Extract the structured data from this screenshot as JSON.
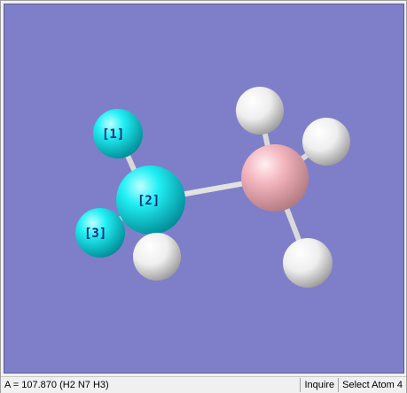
{
  "viewer": {
    "background_color": "#7f7fc9",
    "atoms": [
      {
        "id": "atom-1",
        "label": "[1]",
        "element": "N",
        "color": "#00e5ee"
      },
      {
        "id": "atom-2",
        "label": "[2]",
        "element": "N",
        "color": "#00e5ee"
      },
      {
        "id": "atom-3",
        "label": "[3]",
        "element": "N",
        "color": "#00e5ee"
      },
      {
        "id": "atom-4",
        "label": "",
        "element": "B",
        "color": "#f0b0b8"
      },
      {
        "id": "atom-h",
        "label": "",
        "element": "H",
        "color": "#f5f5f5"
      }
    ]
  },
  "statusbar": {
    "measurement": "A = 107.870 (H2 N7 H3)",
    "mode": "Inquire",
    "selection": "Select Atom 4"
  }
}
